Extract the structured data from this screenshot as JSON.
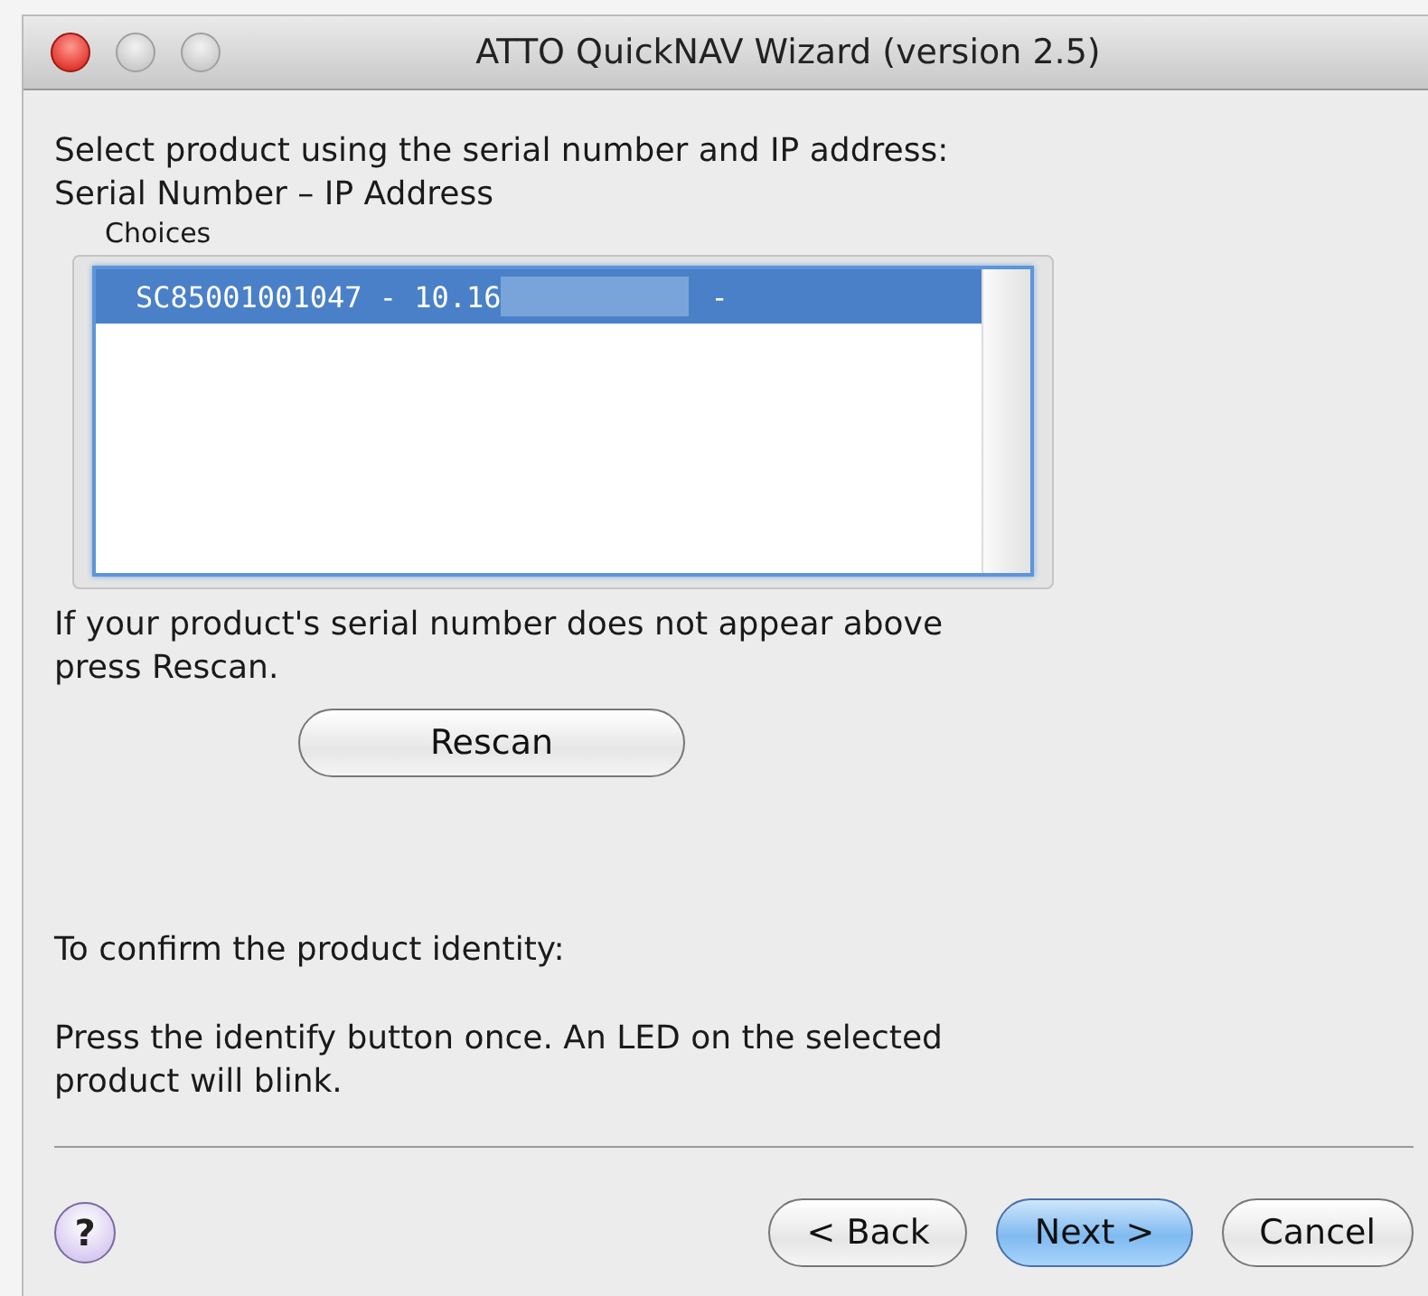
{
  "window": {
    "title": "ATTO QuickNAV Wizard (version 2.5)"
  },
  "instruction": "Select product using the serial number and IP address:",
  "list_heading": "Serial Number – IP Address",
  "group_label": "Choices",
  "choices": [
    {
      "label": "SC85001001047 - 10.16",
      "redacted": true,
      "suffix": "-",
      "selected": true
    }
  ],
  "rescan_hint": "If your product's serial number does not appear above press Rescan.",
  "rescan_button": "Rescan",
  "confirm_heading": "To confirm the product identity:",
  "confirm_text": "Press the identify button once. An LED on the selected product will blink.",
  "help_button": "?",
  "buttons": [
    {
      "label": "< Back",
      "kind": "normal"
    },
    {
      "label": "Next >",
      "kind": "default"
    },
    {
      "label": "Cancel",
      "kind": "normal"
    }
  ]
}
